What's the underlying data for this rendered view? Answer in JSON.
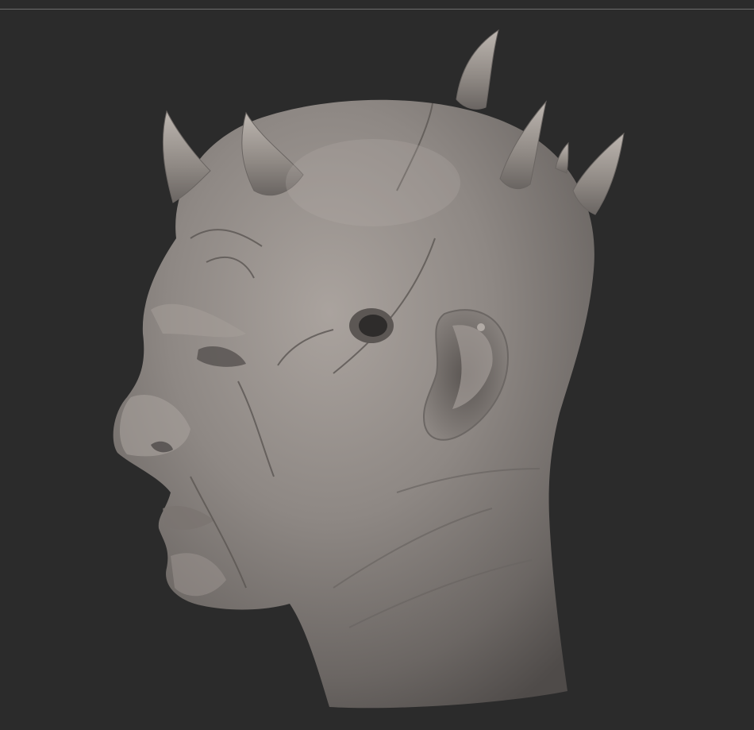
{
  "viewport": {
    "background": "#2b2b2b",
    "separator_color": "#6e6e6e"
  },
  "model": {
    "subject": "sculpted-head-with-horns",
    "view": "left-profile",
    "material_color": "#8c8682",
    "horn_count": 6
  }
}
